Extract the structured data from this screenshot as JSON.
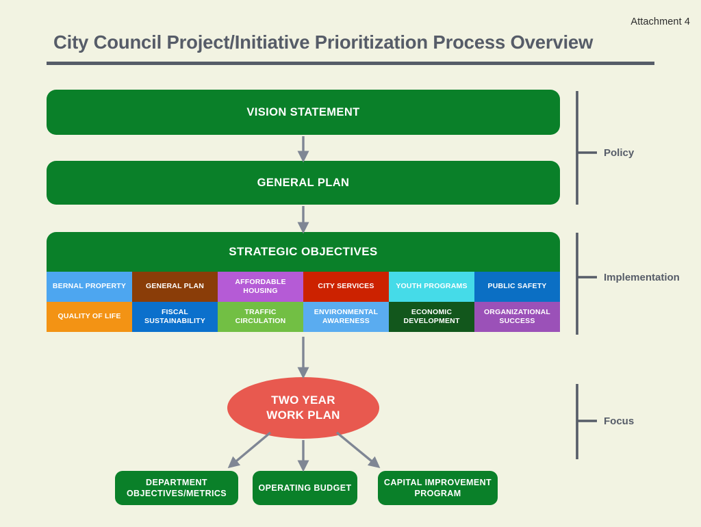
{
  "document": {
    "attachment_label": "Attachment 4",
    "title": "City Council Project/Initiative Prioritization Process Overview",
    "background_color": "#f2f3e2",
    "rule_color": "#565c68"
  },
  "flow": {
    "vision": {
      "label": "VISION STATEMENT",
      "color": "#0a8029"
    },
    "general_plan": {
      "label": "GENERAL PLAN",
      "color": "#0a8029"
    },
    "strategic": {
      "header": "STRATEGIC OBJECTIVES",
      "color": "#0a8029",
      "objectives": [
        {
          "label": "BERNAL PROPERTY",
          "color": "#4da6f0"
        },
        {
          "label": "GENERAL PLAN",
          "color": "#8a3d08"
        },
        {
          "label": "AFFORDABLE HOUSING",
          "color": "#b55bd6"
        },
        {
          "label": "CITY SERVICES",
          "color": "#cc2200"
        },
        {
          "label": "YOUTH PROGRAMS",
          "color": "#45dbe8"
        },
        {
          "label": "PUBLIC SAFETY",
          "color": "#0b6fc4"
        },
        {
          "label": "QUALITY OF LIFE",
          "color": "#f39314"
        },
        {
          "label": "FISCAL SUSTAINABILITY",
          "color": "#0b70cc"
        },
        {
          "label": "TRAFFIC CIRCULATION",
          "color": "#72bf44"
        },
        {
          "label": "ENVIRONMENTAL AWARENESS",
          "color": "#5aacf0"
        },
        {
          "label": "ECONOMIC DEVELOPMENT",
          "color": "#12571c"
        },
        {
          "label": "ORGANIZATIONAL SUCCESS",
          "color": "#9b51b8"
        }
      ]
    },
    "work_plan": {
      "line1": "TWO YEAR",
      "line2": "WORK PLAN",
      "color": "#e8594f"
    },
    "outputs": [
      {
        "line1": "DEPARTMENT",
        "line2": "OBJECTIVES/METRICS",
        "color": "#0a8029"
      },
      {
        "line1": "OPERATING BUDGET",
        "line2": "",
        "color": "#0a8029"
      },
      {
        "line1": "CAPITAL IMPROVEMENT",
        "line2": "PROGRAM",
        "color": "#0a8029"
      }
    ],
    "arrow_color": "#7f8694"
  },
  "phases": [
    {
      "label": "Policy"
    },
    {
      "label": "Implementation"
    },
    {
      "label": "Focus"
    }
  ]
}
